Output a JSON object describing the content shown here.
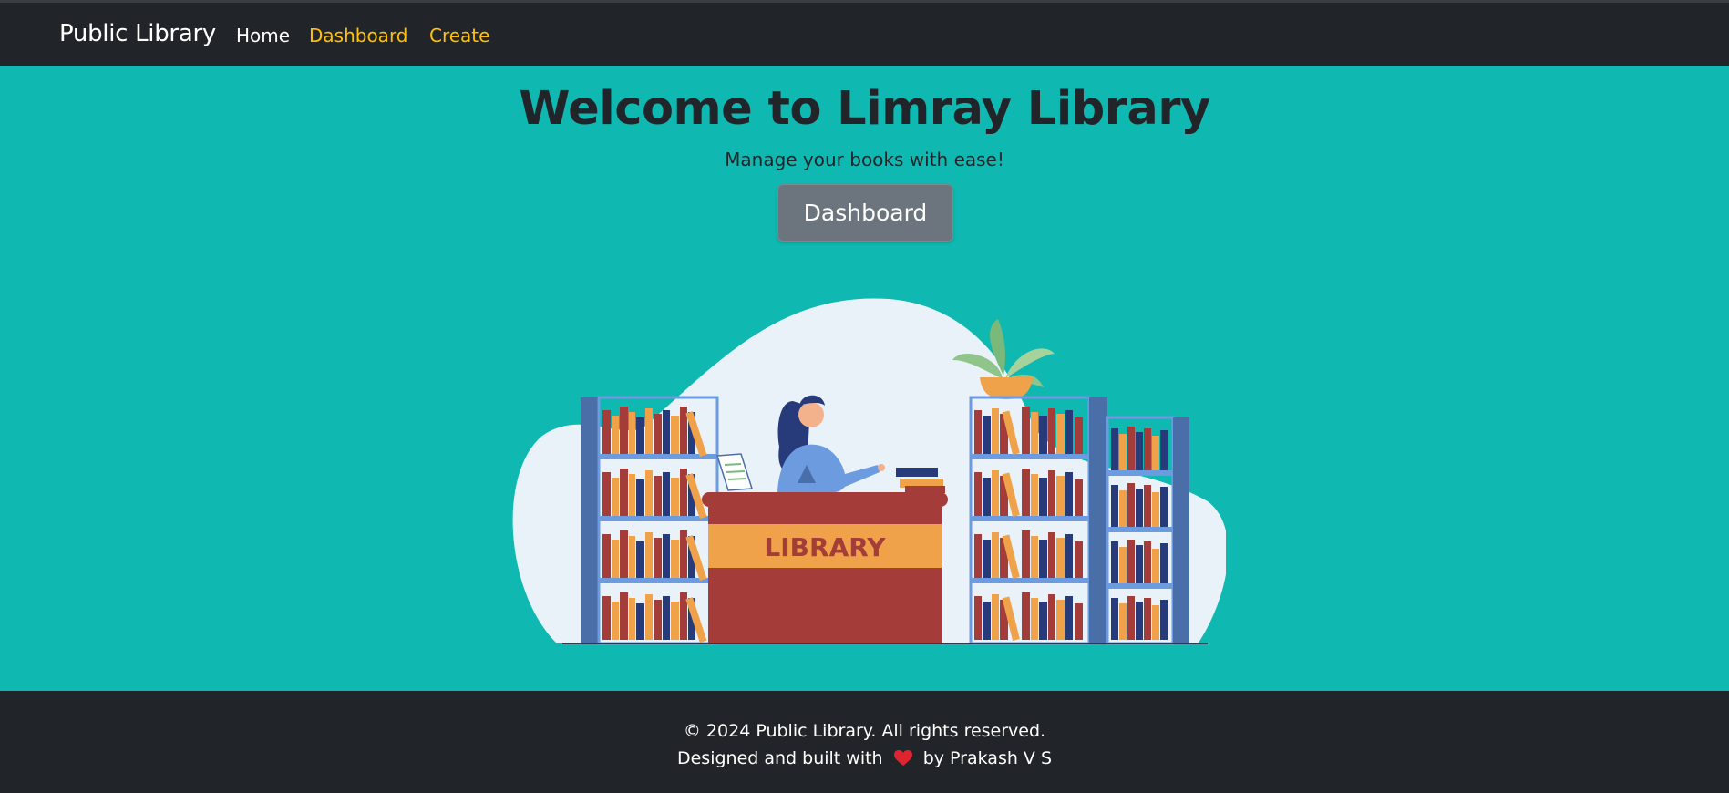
{
  "navbar": {
    "brand": "Public Library",
    "links": [
      {
        "label": "Home",
        "color": "#ffffff"
      },
      {
        "label": "Dashboard",
        "color": "#ffc107"
      },
      {
        "label": "Create",
        "color": "#ffc107"
      }
    ],
    "background": "#212529"
  },
  "hero": {
    "title": "Welcome to Limray Library",
    "subtitle": "Manage your books with ease!",
    "button_label": "Dashboard",
    "background": "#0fb8b1",
    "button_color": "#6c757d"
  },
  "illustration": {
    "desk_sign": "LIBRARY",
    "icon": "librarian-illustration"
  },
  "footer": {
    "copyright": "© 2024 Public Library. All rights reserved.",
    "credit_prefix": "Designed and built with",
    "credit_icon": "heart-icon",
    "credit_suffix": "by Prakash V S"
  }
}
